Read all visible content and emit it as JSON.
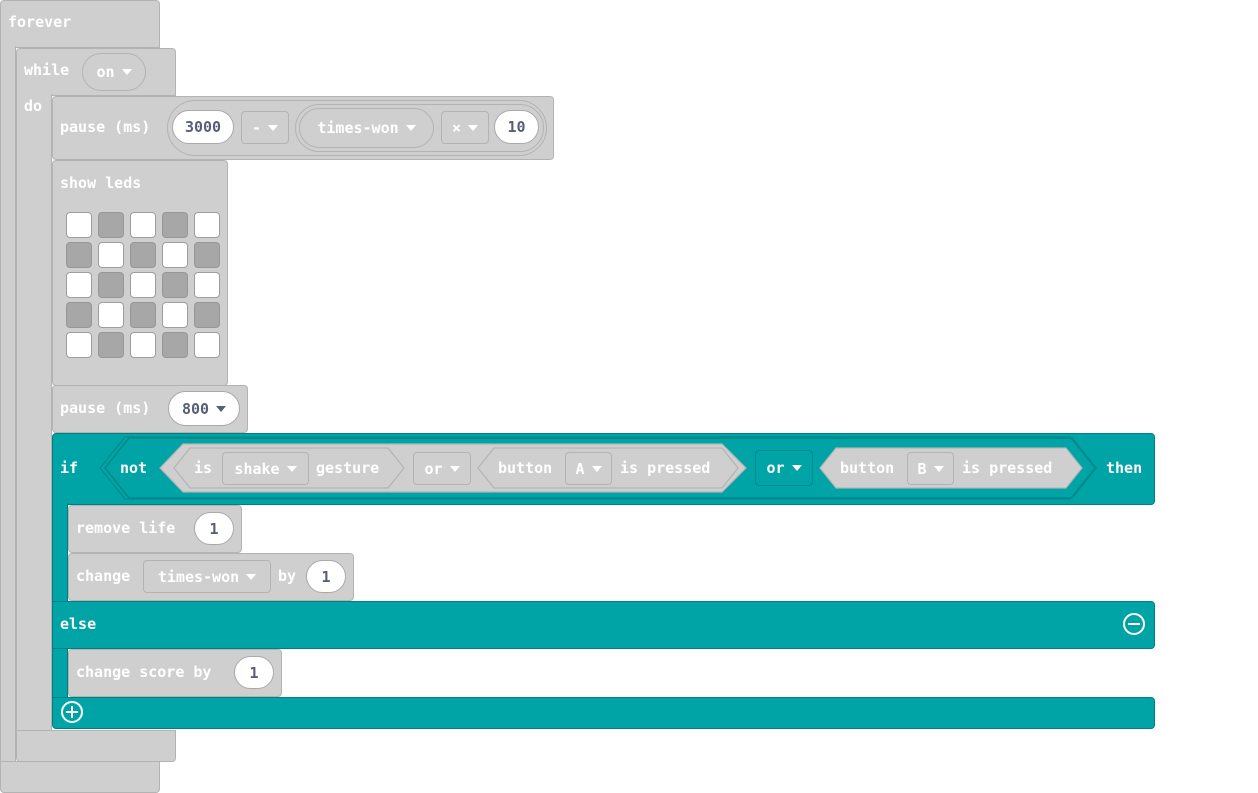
{
  "forever": {
    "label": "forever"
  },
  "while_block": {
    "label": "while",
    "condition": "on",
    "do_label": "do"
  },
  "pause1": {
    "label": "pause (ms)",
    "operand_a": "3000",
    "operator": "-",
    "variable": "times-won",
    "operator2": "×",
    "operand_b": "10"
  },
  "show_leds": {
    "label": "show leds",
    "grid": [
      [
        1,
        0,
        1,
        0,
        1
      ],
      [
        0,
        1,
        0,
        1,
        0
      ],
      [
        1,
        0,
        1,
        0,
        1
      ],
      [
        0,
        1,
        0,
        1,
        0
      ],
      [
        1,
        0,
        1,
        0,
        1
      ]
    ]
  },
  "pause2": {
    "label": "pause (ms)",
    "value": "800"
  },
  "if_block": {
    "if_label": "if",
    "not_label": "not",
    "gesture": {
      "is_label": "is",
      "value": "shake",
      "suffix": "gesture"
    },
    "or_inner": "or",
    "button_a": {
      "label": "button",
      "button": "A",
      "suffix": "is pressed"
    },
    "or_outer": "or",
    "button_b": {
      "label": "button",
      "button": "B",
      "suffix": "is pressed"
    },
    "then_label": "then",
    "else_label": "else"
  },
  "remove_life": {
    "label": "remove life",
    "value": "1"
  },
  "change_var": {
    "label": "change",
    "variable": "times-won",
    "by_label": "by",
    "value": "1"
  },
  "change_score": {
    "label": "change score by",
    "value": "1"
  },
  "colors": {
    "logic": "#00a4a6",
    "disabled_gray": "#cfcfcf"
  }
}
